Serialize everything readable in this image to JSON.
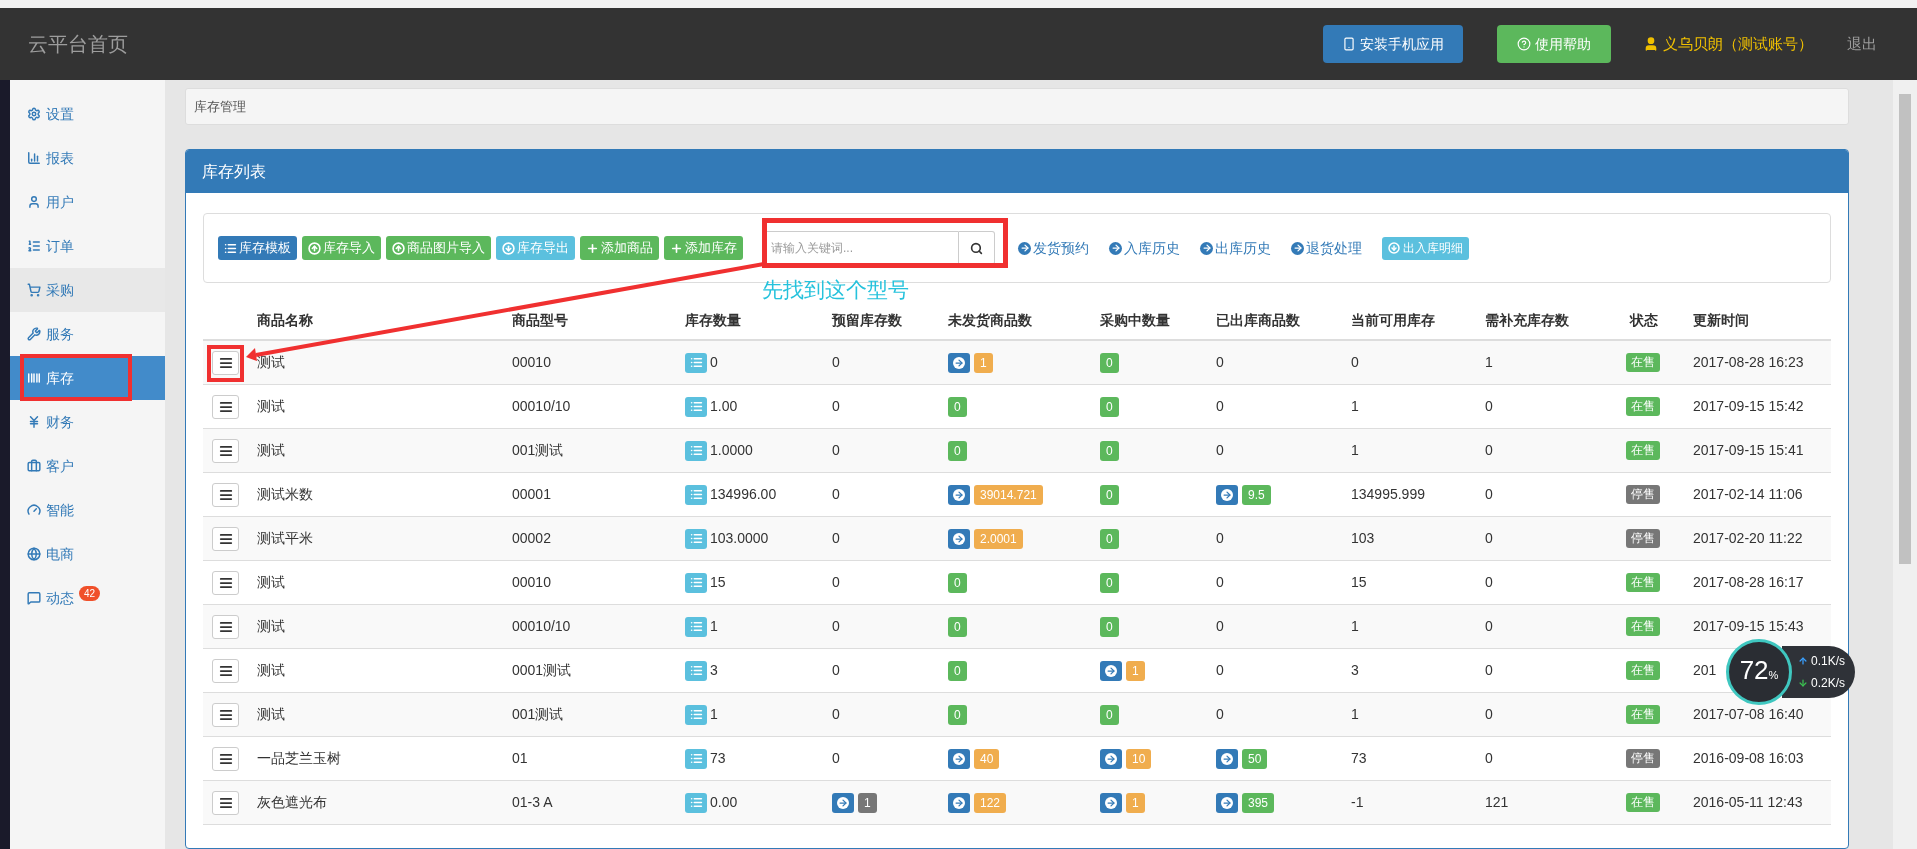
{
  "header": {
    "title": "云平台首页",
    "buttons": [
      {
        "label": "安装手机应用",
        "color": "#337ab7"
      },
      {
        "label": "使用帮助",
        "color": "#5cb85c"
      }
    ],
    "user": "义乌贝朗（测试账号）",
    "logout": "退出"
  },
  "sidebar": {
    "items": [
      {
        "label": "设置",
        "selected": false,
        "hovered": false
      },
      {
        "label": "报表",
        "selected": false,
        "hovered": false
      },
      {
        "label": "用户",
        "selected": false,
        "hovered": false
      },
      {
        "label": "订单",
        "selected": false,
        "hovered": false
      },
      {
        "label": "采购",
        "selected": false,
        "hovered": true
      },
      {
        "label": "服务",
        "selected": false,
        "hovered": false
      },
      {
        "label": "库存",
        "selected": true,
        "hovered": false
      },
      {
        "label": "财务",
        "selected": false,
        "hovered": false
      },
      {
        "label": "客户",
        "selected": false,
        "hovered": false
      },
      {
        "label": "智能",
        "selected": false,
        "hovered": false
      },
      {
        "label": "电商",
        "selected": false,
        "hovered": false
      },
      {
        "label": "动态",
        "selected": false,
        "hovered": false,
        "badge": "42"
      }
    ]
  },
  "breadcrumb": "库存管理",
  "panel_title": "库存列表",
  "toolbar": {
    "buttons": [
      {
        "label": "库存模板",
        "color": "#337ab7"
      },
      {
        "label": "库存导入",
        "color": "#5cb85c"
      },
      {
        "label": "商品图片导入",
        "color": "#5cb85c"
      },
      {
        "label": "库存导出",
        "color": "#5bc0de"
      },
      {
        "label": "添加商品",
        "color": "#5cb85c"
      },
      {
        "label": "添加库存",
        "color": "#5cb85c"
      }
    ],
    "search": {
      "placeholder": "请输入关键词..."
    },
    "links": [
      {
        "label": "发货预约",
        "kind": "link"
      },
      {
        "label": "入库历史",
        "kind": "link"
      },
      {
        "label": "出库历史",
        "kind": "link"
      },
      {
        "label": "退货处理",
        "kind": "link"
      },
      {
        "label": "出入库明细",
        "kind": "button"
      }
    ]
  },
  "table": {
    "columns": [
      "商品名称",
      "商品型号",
      "库存数量",
      "预留库存数",
      "未发货商品数",
      "采购中数量",
      "已出库商品数",
      "当前可用库存",
      "需补充库存数",
      "状态",
      "更新时间"
    ],
    "rows": [
      {
        "name": "测试",
        "model": "00010",
        "stock": "0",
        "counts": [
          {
            "kind": "text",
            "text": "0"
          },
          {
            "kind": "badge",
            "text": "1",
            "color": "#f0ad4e",
            "arrow": true
          },
          {
            "kind": "badge",
            "text": "0",
            "color": "#5cb85c",
            "arrow": false
          },
          {
            "kind": "text",
            "text": "0"
          },
          {
            "kind": "text",
            "text": "0"
          },
          {
            "kind": "text",
            "text": "1"
          }
        ],
        "status": {
          "label": "在售",
          "color": "#5cb85c"
        },
        "time": "2017-08-28 16:23"
      },
      {
        "name": "测试",
        "model": "00010/10",
        "stock": "1.00",
        "counts": [
          {
            "kind": "text",
            "text": "0"
          },
          {
            "kind": "badge",
            "text": "0",
            "color": "#5cb85c",
            "arrow": false
          },
          {
            "kind": "badge",
            "text": "0",
            "color": "#5cb85c",
            "arrow": false
          },
          {
            "kind": "text",
            "text": "0"
          },
          {
            "kind": "text",
            "text": "1"
          },
          {
            "kind": "text",
            "text": "0"
          }
        ],
        "status": {
          "label": "在售",
          "color": "#5cb85c"
        },
        "time": "2017-09-15 15:42"
      },
      {
        "name": "测试",
        "model": "001测试",
        "stock": "1.0000",
        "counts": [
          {
            "kind": "text",
            "text": "0"
          },
          {
            "kind": "badge",
            "text": "0",
            "color": "#5cb85c",
            "arrow": false
          },
          {
            "kind": "badge",
            "text": "0",
            "color": "#5cb85c",
            "arrow": false
          },
          {
            "kind": "text",
            "text": "0"
          },
          {
            "kind": "text",
            "text": "1"
          },
          {
            "kind": "text",
            "text": "0"
          }
        ],
        "status": {
          "label": "在售",
          "color": "#5cb85c"
        },
        "time": "2017-09-15 15:41"
      },
      {
        "name": "测试米数",
        "model": "00001",
        "stock": "134996.00",
        "counts": [
          {
            "kind": "text",
            "text": "0"
          },
          {
            "kind": "badge",
            "text": "39014.721",
            "color": "#f0ad4e",
            "arrow": true
          },
          {
            "kind": "badge",
            "text": "0",
            "color": "#5cb85c",
            "arrow": false
          },
          {
            "kind": "badge",
            "text": "9.5",
            "color": "#5cb85c",
            "arrow": true
          },
          {
            "kind": "text",
            "text": "134995.999"
          },
          {
            "kind": "text",
            "text": "0"
          }
        ],
        "status": {
          "label": "停售",
          "color": "#777777"
        },
        "time": "2017-02-14 11:06"
      },
      {
        "name": "测试平米",
        "model": "00002",
        "stock": "103.0000",
        "counts": [
          {
            "kind": "text",
            "text": "0"
          },
          {
            "kind": "badge",
            "text": "2.0001",
            "color": "#f0ad4e",
            "arrow": true
          },
          {
            "kind": "badge",
            "text": "0",
            "color": "#5cb85c",
            "arrow": false
          },
          {
            "kind": "text",
            "text": "0"
          },
          {
            "kind": "text",
            "text": "103"
          },
          {
            "kind": "text",
            "text": "0"
          }
        ],
        "status": {
          "label": "停售",
          "color": "#777777"
        },
        "time": "2017-02-20 11:22"
      },
      {
        "name": "测试",
        "model": "00010",
        "stock": "15",
        "counts": [
          {
            "kind": "text",
            "text": "0"
          },
          {
            "kind": "badge",
            "text": "0",
            "color": "#5cb85c",
            "arrow": false
          },
          {
            "kind": "badge",
            "text": "0",
            "color": "#5cb85c",
            "arrow": false
          },
          {
            "kind": "text",
            "text": "0"
          },
          {
            "kind": "text",
            "text": "15"
          },
          {
            "kind": "text",
            "text": "0"
          }
        ],
        "status": {
          "label": "在售",
          "color": "#5cb85c"
        },
        "time": "2017-08-28 16:17"
      },
      {
        "name": "测试",
        "model": "00010/10",
        "stock": "1",
        "counts": [
          {
            "kind": "text",
            "text": "0"
          },
          {
            "kind": "badge",
            "text": "0",
            "color": "#5cb85c",
            "arrow": false
          },
          {
            "kind": "badge",
            "text": "0",
            "color": "#5cb85c",
            "arrow": false
          },
          {
            "kind": "text",
            "text": "0"
          },
          {
            "kind": "text",
            "text": "1"
          },
          {
            "kind": "text",
            "text": "0"
          }
        ],
        "status": {
          "label": "在售",
          "color": "#5cb85c"
        },
        "time": "2017-09-15 15:43"
      },
      {
        "name": "测试",
        "model": "0001测试",
        "stock": "3",
        "counts": [
          {
            "kind": "text",
            "text": "0"
          },
          {
            "kind": "badge",
            "text": "0",
            "color": "#5cb85c",
            "arrow": false
          },
          {
            "kind": "badge",
            "text": "1",
            "color": "#f0ad4e",
            "arrow": true
          },
          {
            "kind": "text",
            "text": "0"
          },
          {
            "kind": "text",
            "text": "3"
          },
          {
            "kind": "text",
            "text": "0"
          }
        ],
        "status": {
          "label": "在售",
          "color": "#5cb85c"
        },
        "time": "201"
      },
      {
        "name": "测试",
        "model": "001测试",
        "stock": "1",
        "counts": [
          {
            "kind": "text",
            "text": "0"
          },
          {
            "kind": "badge",
            "text": "0",
            "color": "#5cb85c",
            "arrow": false
          },
          {
            "kind": "badge",
            "text": "0",
            "color": "#5cb85c",
            "arrow": false
          },
          {
            "kind": "text",
            "text": "0"
          },
          {
            "kind": "text",
            "text": "1"
          },
          {
            "kind": "text",
            "text": "0"
          }
        ],
        "status": {
          "label": "在售",
          "color": "#5cb85c"
        },
        "time": "2017-07-08 16:40"
      },
      {
        "name": "一品芝兰玉树",
        "model": "01",
        "stock": "73",
        "counts": [
          {
            "kind": "text",
            "text": "0"
          },
          {
            "kind": "badge",
            "text": "40",
            "color": "#f0ad4e",
            "arrow": true
          },
          {
            "kind": "badge",
            "text": "10",
            "color": "#f0ad4e",
            "arrow": true
          },
          {
            "kind": "badge",
            "text": "50",
            "color": "#5cb85c",
            "arrow": true
          },
          {
            "kind": "text",
            "text": "73"
          },
          {
            "kind": "text",
            "text": "0"
          }
        ],
        "status": {
          "label": "停售",
          "color": "#777777"
        },
        "time": "2016-09-08 16:03"
      },
      {
        "name": "灰色遮光布",
        "model": "01-3 A",
        "stock": "0.00",
        "counts": [
          {
            "kind": "badge",
            "text": "1",
            "color": "#777777",
            "arrow": true
          },
          {
            "kind": "badge",
            "text": "122",
            "color": "#f0ad4e",
            "arrow": true
          },
          {
            "kind": "badge",
            "text": "1",
            "color": "#f0ad4e",
            "arrow": true
          },
          {
            "kind": "badge",
            "text": "395",
            "color": "#5cb85c",
            "arrow": true
          },
          {
            "kind": "text",
            "text": "-1"
          },
          {
            "kind": "text",
            "text": "121"
          }
        ],
        "status": {
          "label": "在售",
          "color": "#5cb85c"
        },
        "time": "2016-05-11 12:43"
      }
    ]
  },
  "annotation": {
    "text": "先找到这个型号"
  },
  "net_widget": {
    "percent": "72",
    "unit": "%",
    "up": "0.1K/s",
    "down": "0.2K/s"
  }
}
